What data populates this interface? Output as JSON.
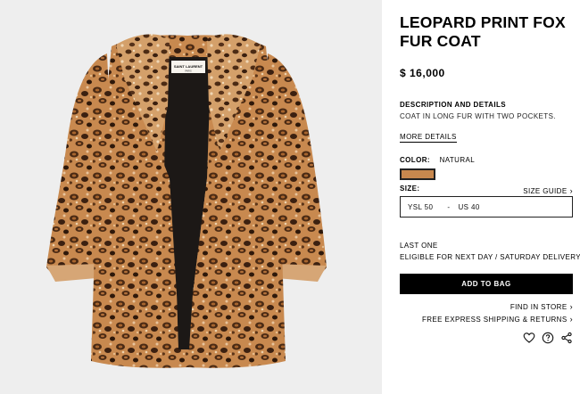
{
  "product": {
    "title_line1": "LEOPARD PRINT FOX",
    "title_line2": "FUR COAT",
    "price": "$ 16,000",
    "description_heading": "DESCRIPTION AND DETAILS",
    "description_text": "COAT IN LONG FUR WITH TWO POCKETS.",
    "more_details": "MORE DETAILS",
    "color_label": "COLOR:",
    "color_value": "NATURAL",
    "swatch_color": "#c8884e",
    "size_label": "SIZE:",
    "size_guide": "SIZE GUIDE",
    "size_ysl": "YSL 50",
    "size_sep": "-",
    "size_us": "US 40",
    "stock_text": "LAST ONE",
    "delivery_text": "ELIGIBLE FOR NEXT DAY / SATURDAY DELIVERY",
    "add_to_bag": "ADD TO BAG",
    "find_in_store": "FIND IN STORE",
    "shipping_returns": "FREE EXPRESS SHIPPING & RETURNS",
    "chevron": "›"
  },
  "image": {
    "label_line1": "SAINT LAURENT",
    "label_line2": "PARIS",
    "background": "#eeeeee",
    "fur_color": "#c8884e",
    "lining_color": "#1c1816"
  },
  "icons": [
    "heart-icon",
    "help-icon",
    "share-icon"
  ]
}
